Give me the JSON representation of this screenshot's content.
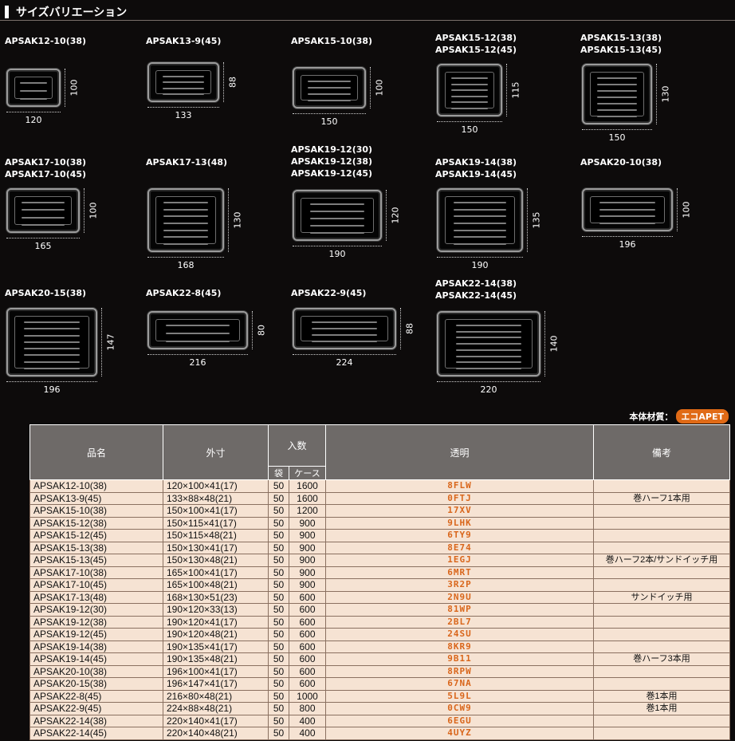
{
  "header": {
    "title": "サイズバリエーション"
  },
  "products": [
    {
      "names": [
        "APSAK12-10(38)"
      ],
      "w": "120",
      "h": "100"
    },
    {
      "names": [
        "APSAK13-9(45)"
      ],
      "w": "133",
      "h": "88"
    },
    {
      "names": [
        "APSAK15-10(38)"
      ],
      "w": "150",
      "h": "100"
    },
    {
      "names": [
        "APSAK15-12(38)",
        "APSAK15-12(45)"
      ],
      "w": "150",
      "h": "115"
    },
    {
      "names": [
        "APSAK15-13(38)",
        "APSAK15-13(45)"
      ],
      "w": "150",
      "h": "130"
    },
    {
      "names": [
        "APSAK17-10(38)",
        "APSAK17-10(45)"
      ],
      "w": "165",
      "h": "100"
    },
    {
      "names": [
        "APSAK17-13(48)"
      ],
      "w": "168",
      "h": "130"
    },
    {
      "names": [
        "APSAK19-12(30)",
        "APSAK19-12(38)",
        "APSAK19-12(45)"
      ],
      "w": "190",
      "h": "120"
    },
    {
      "names": [
        "APSAK19-14(38)",
        "APSAK19-14(45)"
      ],
      "w": "190",
      "h": "135"
    },
    {
      "names": [
        "APSAK20-10(38)"
      ],
      "w": "196",
      "h": "100"
    },
    {
      "names": [
        "APSAK20-15(38)"
      ],
      "w": "196",
      "h": "147"
    },
    {
      "names": [
        "APSAK22-8(45)"
      ],
      "w": "216",
      "h": "80"
    },
    {
      "names": [
        "APSAK22-9(45)"
      ],
      "w": "224",
      "h": "88"
    },
    {
      "names": [
        "APSAK22-14(38)",
        "APSAK22-14(45)"
      ],
      "w": "220",
      "h": "140"
    }
  ],
  "material": {
    "label": "本体材質：",
    "badge": "エコAPET",
    "badge_color": "#e06a16"
  },
  "table": {
    "headers": {
      "name": "品名",
      "size": "外寸",
      "qty": "入数",
      "bag": "袋",
      "case": "ケース",
      "clear": "透明",
      "note": "備考"
    },
    "rows": [
      {
        "name": "APSAK12-10(38)",
        "size": "120×100×41(17)",
        "bag": "50",
        "case": "1600",
        "code": "8FLW",
        "note": ""
      },
      {
        "name": "APSAK13-9(45)",
        "size": "133×88×48(21)",
        "bag": "50",
        "case": "1600",
        "code": "0FTJ",
        "note": "巻ハーフ1本用"
      },
      {
        "name": "APSAK15-10(38)",
        "size": "150×100×41(17)",
        "bag": "50",
        "case": "1200",
        "code": "17XV",
        "note": ""
      },
      {
        "name": "APSAK15-12(38)",
        "size": "150×115×41(17)",
        "bag": "50",
        "case": "900",
        "code": "9LHK",
        "note": ""
      },
      {
        "name": "APSAK15-12(45)",
        "size": "150×115×48(21)",
        "bag": "50",
        "case": "900",
        "code": "6TY9",
        "note": ""
      },
      {
        "name": "APSAK15-13(38)",
        "size": "150×130×41(17)",
        "bag": "50",
        "case": "900",
        "code": "8E74",
        "note": ""
      },
      {
        "name": "APSAK15-13(45)",
        "size": "150×130×48(21)",
        "bag": "50",
        "case": "900",
        "code": "1EGJ",
        "note": "巻ハーフ2本/サンドイッチ用"
      },
      {
        "name": "APSAK17-10(38)",
        "size": "165×100×41(17)",
        "bag": "50",
        "case": "900",
        "code": "6MRT",
        "note": ""
      },
      {
        "name": "APSAK17-10(45)",
        "size": "165×100×48(21)",
        "bag": "50",
        "case": "900",
        "code": "3R2P",
        "note": ""
      },
      {
        "name": "APSAK17-13(48)",
        "size": "168×130×51(23)",
        "bag": "50",
        "case": "600",
        "code": "2N9U",
        "note": "サンドイッチ用"
      },
      {
        "name": "APSAK19-12(30)",
        "size": "190×120×33(13)",
        "bag": "50",
        "case": "600",
        "code": "81WP",
        "note": ""
      },
      {
        "name": "APSAK19-12(38)",
        "size": "190×120×41(17)",
        "bag": "50",
        "case": "600",
        "code": "2BL7",
        "note": ""
      },
      {
        "name": "APSAK19-12(45)",
        "size": "190×120×48(21)",
        "bag": "50",
        "case": "600",
        "code": "24SU",
        "note": ""
      },
      {
        "name": "APSAK19-14(38)",
        "size": "190×135×41(17)",
        "bag": "50",
        "case": "600",
        "code": "8KR9",
        "note": ""
      },
      {
        "name": "APSAK19-14(45)",
        "size": "190×135×48(21)",
        "bag": "50",
        "case": "600",
        "code": "9B11",
        "note": "巻ハーフ3本用"
      },
      {
        "name": "APSAK20-10(38)",
        "size": "196×100×41(17)",
        "bag": "50",
        "case": "600",
        "code": "8RPW",
        "note": ""
      },
      {
        "name": "APSAK20-15(38)",
        "size": "196×147×41(17)",
        "bag": "50",
        "case": "600",
        "code": "67NA",
        "note": ""
      },
      {
        "name": "APSAK22-8(45)",
        "size": "216×80×48(21)",
        "bag": "50",
        "case": "1000",
        "code": "5L9L",
        "note": "巻1本用"
      },
      {
        "name": "APSAK22-9(45)",
        "size": "224×88×48(21)",
        "bag": "50",
        "case": "800",
        "code": "0CW9",
        "note": "巻1本用"
      },
      {
        "name": "APSAK22-14(38)",
        "size": "220×140×41(17)",
        "bag": "50",
        "case": "400",
        "code": "6EGU",
        "note": ""
      },
      {
        "name": "APSAK22-14(45)",
        "size": "220×140×48(21)",
        "bag": "50",
        "case": "400",
        "code": "4UYZ",
        "note": ""
      }
    ]
  }
}
